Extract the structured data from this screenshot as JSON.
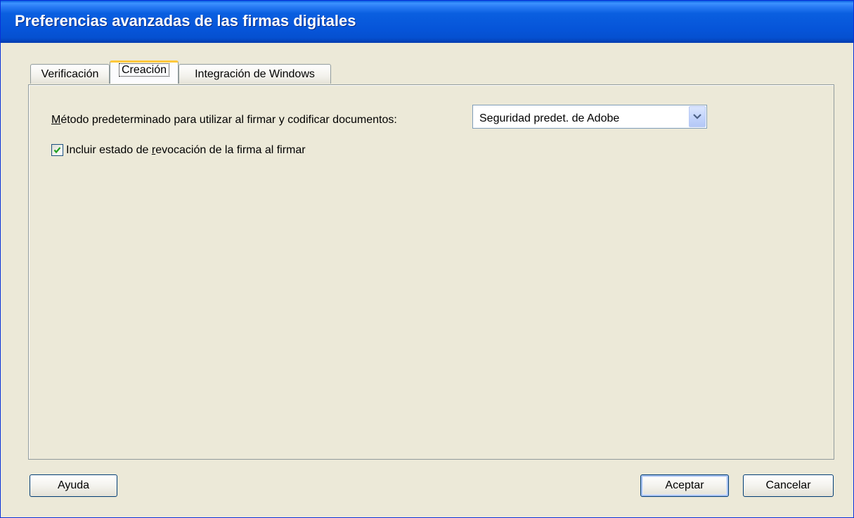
{
  "window": {
    "title": "Preferencias avanzadas de las firmas digitales"
  },
  "tabs": [
    {
      "label": "Verificación",
      "active": false
    },
    {
      "label": "Creación",
      "active": true
    },
    {
      "label": "Integración de Windows",
      "active": false
    }
  ],
  "creation": {
    "method_label_first": "M",
    "method_label_rest": "étodo predeterminado para utilizar al firmar y codificar documentos:",
    "method_selected": "Seguridad predet. de Adobe",
    "include_revocation": {
      "checked": true,
      "label_pre": "Incluir estado de ",
      "label_key": "r",
      "label_post": "evocación de la firma al firmar"
    }
  },
  "buttons": {
    "help": "Ayuda",
    "ok": "Aceptar",
    "cancel": "Cancelar"
  },
  "colors": {
    "titlebar": "#0a5fe0",
    "dialog_bg": "#ece9d8",
    "active_tab_accent": "#ffc83c",
    "checkmark": "#21a121"
  }
}
